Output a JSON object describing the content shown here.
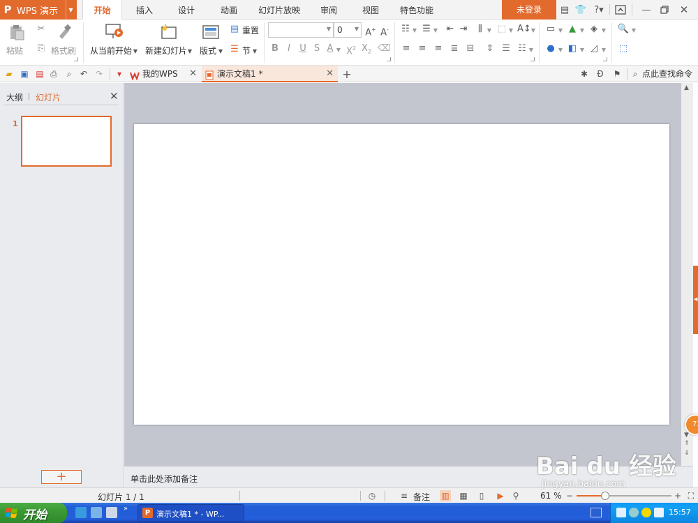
{
  "app": {
    "logo_char": "P",
    "name": "WPS 演示",
    "login_label": "未登录"
  },
  "ribbon_tabs": [
    {
      "label": "开始",
      "active": true
    },
    {
      "label": "插入"
    },
    {
      "label": "设计"
    },
    {
      "label": "动画"
    },
    {
      "label": "幻灯片放映"
    },
    {
      "label": "审阅"
    },
    {
      "label": "视图"
    },
    {
      "label": "特色功能"
    }
  ],
  "ribbon": {
    "paste": "粘贴",
    "format_painter": "格式刷",
    "play_from_current": "从当前开始",
    "new_slide": "新建幻灯片",
    "layout": "版式",
    "reset": "重置",
    "section": "节",
    "font_size": "0"
  },
  "doc_tabs": {
    "my_wps": "我的WPS",
    "current_doc": "演示文稿1 *"
  },
  "command_search": "点此查找命令",
  "left_pane": {
    "outline_tab": "大纲",
    "slides_tab": "幻灯片",
    "slide_number": "1",
    "add_button": "+"
  },
  "notes_placeholder": "单击此处添加备注",
  "status": {
    "slide_count": "幻灯片 1 / 1",
    "notes_label": "备注",
    "zoom_label": "61 %",
    "zoom_fraction": 0.3
  },
  "side_badge": "73",
  "taskbar": {
    "start_label": "开始",
    "task_item": "演示文稿1 * - WP...",
    "clock": "15:57"
  },
  "watermark": {
    "text": "Bai du 经验",
    "sub": "jingyan.baidu.com"
  },
  "colors": {
    "accent": "#e26a2c",
    "workspace": "#c3c6cf",
    "taskbar": "#245edb"
  }
}
